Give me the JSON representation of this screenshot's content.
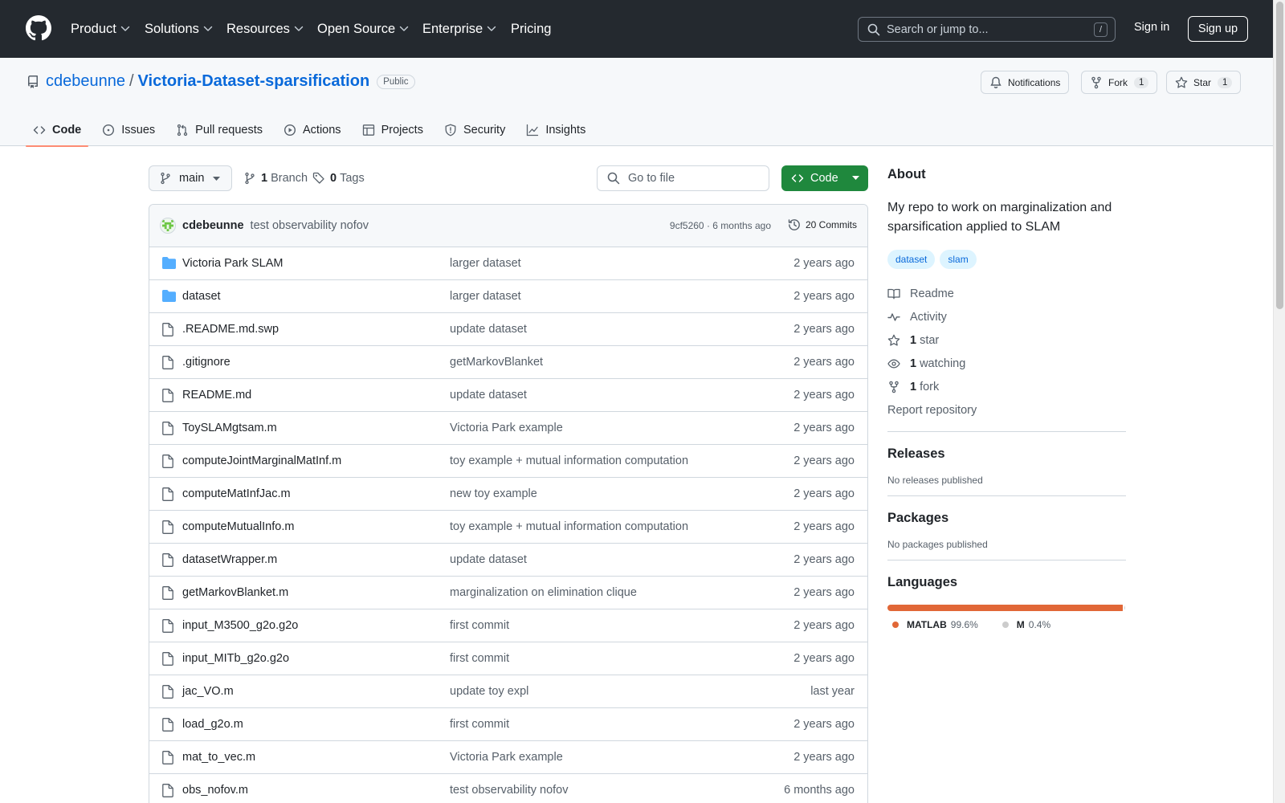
{
  "header": {
    "nav": [
      {
        "label": "Product",
        "dropdown": true
      },
      {
        "label": "Solutions",
        "dropdown": true
      },
      {
        "label": "Resources",
        "dropdown": true
      },
      {
        "label": "Open Source",
        "dropdown": true
      },
      {
        "label": "Enterprise",
        "dropdown": true
      },
      {
        "label": "Pricing",
        "dropdown": false
      }
    ],
    "search_placeholder": "Search or jump to...",
    "search_shortcut": "/",
    "sign_in": "Sign in",
    "sign_up": "Sign up"
  },
  "repo": {
    "owner": "cdebeunne",
    "separator": "/",
    "name": "Victoria-Dataset-sparsification",
    "visibility": "Public",
    "notifications_label": "Notifications",
    "fork_label": "Fork",
    "fork_count": "1",
    "star_label": "Star",
    "star_count": "1"
  },
  "tabs": [
    {
      "label": "Code",
      "icon": "code-icon",
      "active": true
    },
    {
      "label": "Issues",
      "icon": "issue-icon",
      "active": false
    },
    {
      "label": "Pull requests",
      "icon": "pull-request-icon",
      "active": false
    },
    {
      "label": "Actions",
      "icon": "play-icon",
      "active": false
    },
    {
      "label": "Projects",
      "icon": "table-icon",
      "active": false
    },
    {
      "label": "Security",
      "icon": "shield-icon",
      "active": false
    },
    {
      "label": "Insights",
      "icon": "graph-icon",
      "active": false
    }
  ],
  "toolbar": {
    "branch": "main",
    "branch_count": "1",
    "branch_label": "Branch",
    "tag_count": "0",
    "tag_label": "Tags",
    "goto_placeholder": "Go to file",
    "code_button": "Code"
  },
  "latest_commit": {
    "author": "cdebeunne",
    "message": "test observability nofov",
    "meta": "9cf5260 · 6 months ago",
    "commits_label": "20 Commits"
  },
  "files": [
    {
      "name": "Victoria Park SLAM",
      "type": "folder",
      "message": "larger dataset",
      "age": "2 years ago"
    },
    {
      "name": "dataset",
      "type": "folder",
      "message": "larger dataset",
      "age": "2 years ago"
    },
    {
      "name": ".README.md.swp",
      "type": "file",
      "message": "update dataset",
      "age": "2 years ago"
    },
    {
      "name": ".gitignore",
      "type": "file",
      "message": "getMarkovBlanket",
      "age": "2 years ago"
    },
    {
      "name": "README.md",
      "type": "file",
      "message": "update dataset",
      "age": "2 years ago"
    },
    {
      "name": "ToySLAMgtsam.m",
      "type": "file",
      "message": "Victoria Park example",
      "age": "2 years ago"
    },
    {
      "name": "computeJointMarginalMatInf.m",
      "type": "file",
      "message": "toy example + mutual information computation",
      "age": "2 years ago"
    },
    {
      "name": "computeMatInfJac.m",
      "type": "file",
      "message": "new toy example",
      "age": "2 years ago"
    },
    {
      "name": "computeMutualInfo.m",
      "type": "file",
      "message": "toy example + mutual information computation",
      "age": "2 years ago"
    },
    {
      "name": "datasetWrapper.m",
      "type": "file",
      "message": "update dataset",
      "age": "2 years ago"
    },
    {
      "name": "getMarkovBlanket.m",
      "type": "file",
      "message": "marginalization on elimination clique",
      "age": "2 years ago"
    },
    {
      "name": "input_M3500_g2o.g2o",
      "type": "file",
      "message": "first commit",
      "age": "2 years ago"
    },
    {
      "name": "input_MITb_g2o.g2o",
      "type": "file",
      "message": "first commit",
      "age": "2 years ago"
    },
    {
      "name": "jac_VO.m",
      "type": "file",
      "message": "update toy expl",
      "age": "last year"
    },
    {
      "name": "load_g2o.m",
      "type": "file",
      "message": "first commit",
      "age": "2 years ago"
    },
    {
      "name": "mat_to_vec.m",
      "type": "file",
      "message": "Victoria Park example",
      "age": "2 years ago"
    },
    {
      "name": "obs_nofov.m",
      "type": "file",
      "message": "test observability nofov",
      "age": "6 months ago"
    },
    {
      "name": "",
      "type": "file",
      "message": "",
      "age": ""
    }
  ],
  "about": {
    "title": "About",
    "description": "My repo to work on marginalization and sparsification applied to SLAM",
    "topics": [
      "dataset",
      "slam"
    ],
    "links": [
      {
        "icon": "book-icon",
        "count": "",
        "label": "Readme"
      },
      {
        "icon": "pulse-icon",
        "count": "",
        "label": "Activity"
      },
      {
        "icon": "star-icon",
        "count": "1",
        "label": "star"
      },
      {
        "icon": "eye-icon",
        "count": "1",
        "label": "watching"
      },
      {
        "icon": "fork-icon",
        "count": "1",
        "label": "fork"
      }
    ],
    "report": "Report repository"
  },
  "releases": {
    "title": "Releases",
    "note": "No releases published"
  },
  "packages": {
    "title": "Packages",
    "note": "No packages published"
  },
  "languages": {
    "title": "Languages",
    "items": [
      {
        "name": "MATLAB",
        "percent_label": "99.6%",
        "percent": 99.6,
        "color": "#e16737"
      },
      {
        "name": "M",
        "percent_label": "0.4%",
        "percent": 0.4,
        "color": "#cccccc"
      }
    ]
  },
  "colors": {
    "header_bg": "#24292f",
    "link": "#0969da",
    "primary_button": "#1f883d",
    "active_tab_underline": "#fd8c73"
  }
}
